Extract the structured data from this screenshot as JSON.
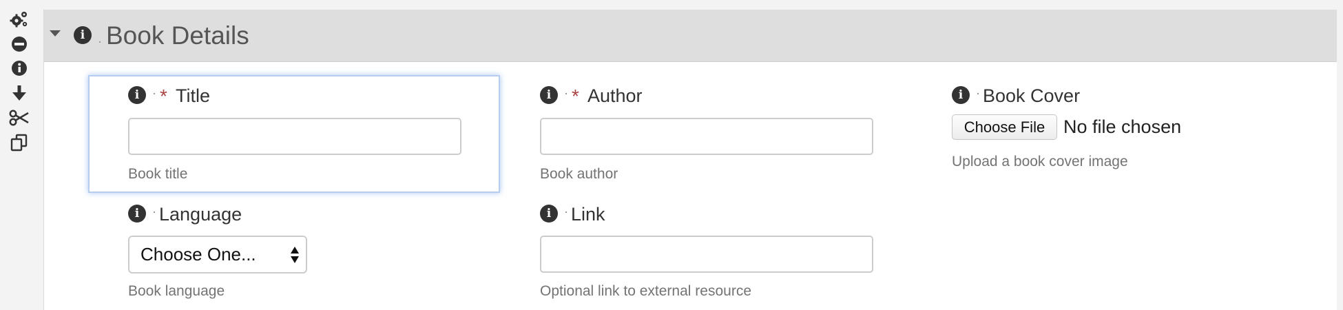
{
  "toolbar": {
    "tools": [
      {
        "icon": "gears-icon"
      },
      {
        "icon": "minus-circle-icon"
      },
      {
        "icon": "info-circle-icon"
      },
      {
        "icon": "arrow-down-icon"
      },
      {
        "icon": "scissors-icon"
      },
      {
        "icon": "copy-icon"
      }
    ]
  },
  "panel": {
    "title": "Book Details",
    "info_glyph": "i"
  },
  "fields": {
    "title": {
      "label": "Title",
      "required_mark": "*",
      "value": "",
      "help": "Book title"
    },
    "author": {
      "label": "Author",
      "required_mark": "*",
      "value": "",
      "help": "Book author"
    },
    "cover": {
      "label": "Book Cover",
      "button_label": "Choose File",
      "status": "No file chosen",
      "help": "Upload a book cover image"
    },
    "language": {
      "label": "Language",
      "selected": "Choose One...",
      "help": "Book language"
    },
    "link": {
      "label": "Link",
      "value": "",
      "help": "Optional link to external resource"
    }
  },
  "colors": {
    "header_bg": "#dedede",
    "required": "#a94442",
    "focus_ring": "#b7cdef",
    "help_text": "#737373"
  }
}
